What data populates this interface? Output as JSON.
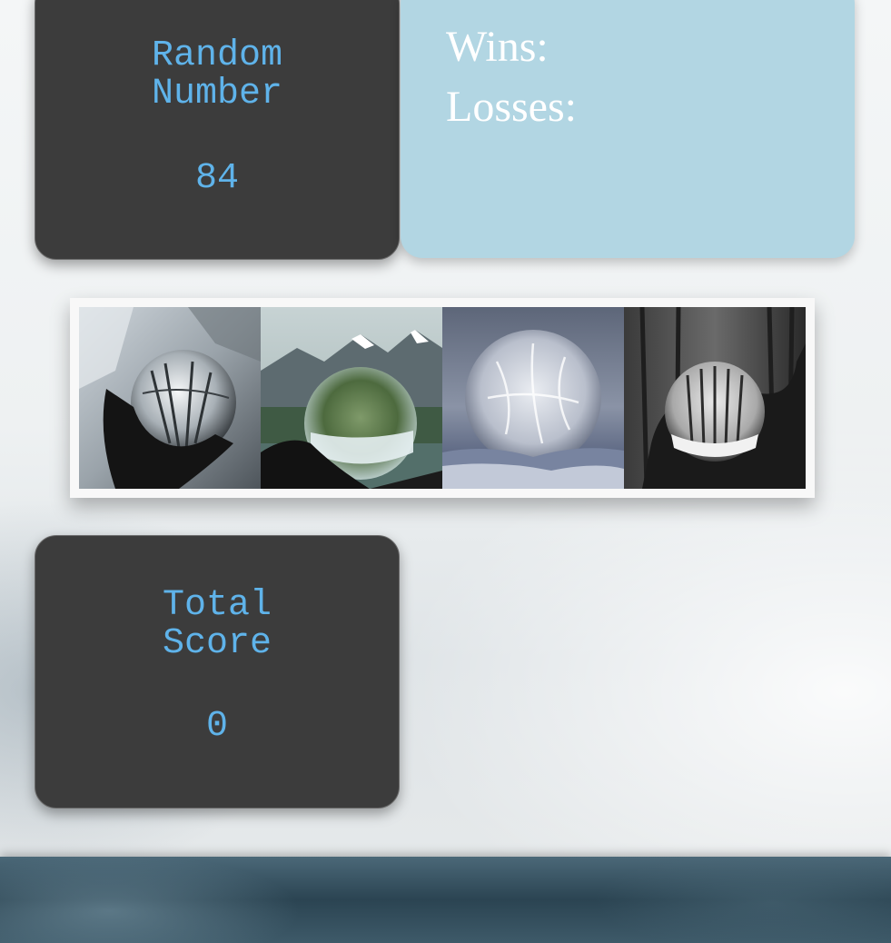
{
  "random_number": {
    "title": "Random\nNumber",
    "value": "84"
  },
  "stats": {
    "wins_label": "Wins:",
    "losses_label": "Losses:"
  },
  "total_score": {
    "title": "Total\nScore",
    "value": "0"
  },
  "crystals": [
    {
      "name": "crystal-ball-architecture"
    },
    {
      "name": "crystal-ball-mountains"
    },
    {
      "name": "frozen-bubble"
    },
    {
      "name": "crystal-ball-forest"
    }
  ],
  "colors": {
    "dark_box": "#3c3c3c",
    "accent_text": "#5fb3ea",
    "stats_box": "#b2d6e3",
    "stats_text": "#ffffff"
  }
}
